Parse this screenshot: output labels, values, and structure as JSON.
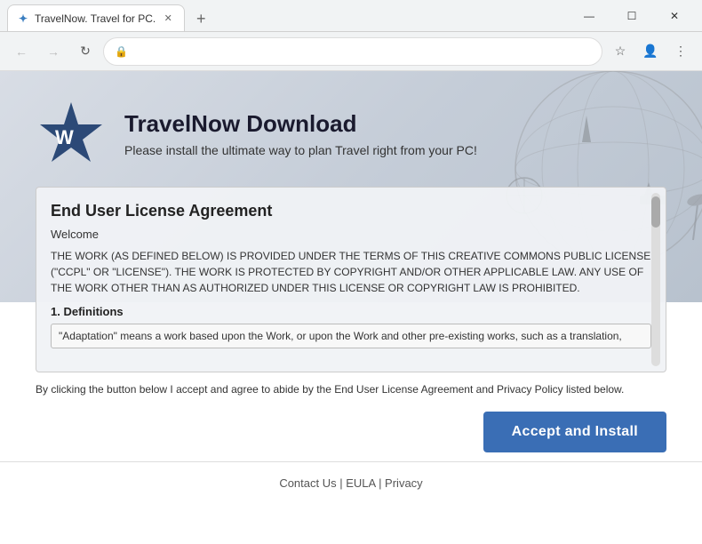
{
  "window": {
    "title": "TravelNow. Travel for PC.",
    "controls": {
      "minimize": "—",
      "maximize": "☐",
      "close": "✕"
    }
  },
  "browser": {
    "tab_label": "TravelNow. Travel for PC.",
    "new_tab_label": "+",
    "nav": {
      "back": "←",
      "forward": "→",
      "refresh": "↻",
      "address_bar_text": ""
    }
  },
  "page": {
    "header": {
      "title": "TravelNow Download",
      "subtitle": "Please install the ultimate way to plan Travel right from your PC!"
    },
    "eula": {
      "title": "End User License Agreement",
      "welcome": "Welcome",
      "body": "THE WORK (AS DEFINED BELOW) IS PROVIDED UNDER THE TERMS OF THIS CREATIVE COMMONS PUBLIC LICENSE (\"CCPL\" OR \"LICENSE\"). THE WORK IS PROTECTED BY COPYRIGHT AND/OR OTHER APPLICABLE LAW. ANY USE OF THE WORK OTHER THAN AS AUTHORIZED UNDER THIS LICENSE OR COPYRIGHT LAW IS PROHIBITED.",
      "section1_title": "1. Definitions",
      "definition_text": "\"Adaptation\" means a work based upon the Work, or upon the Work and other pre-existing works, such as a translation,"
    },
    "consent_text": "By clicking the button below I accept and agree to abide by the End User License Agreement and Privacy Policy listed below.",
    "accept_button": "Accept and Install",
    "footer": {
      "links": "Contact Us | EULA | Privacy"
    }
  }
}
